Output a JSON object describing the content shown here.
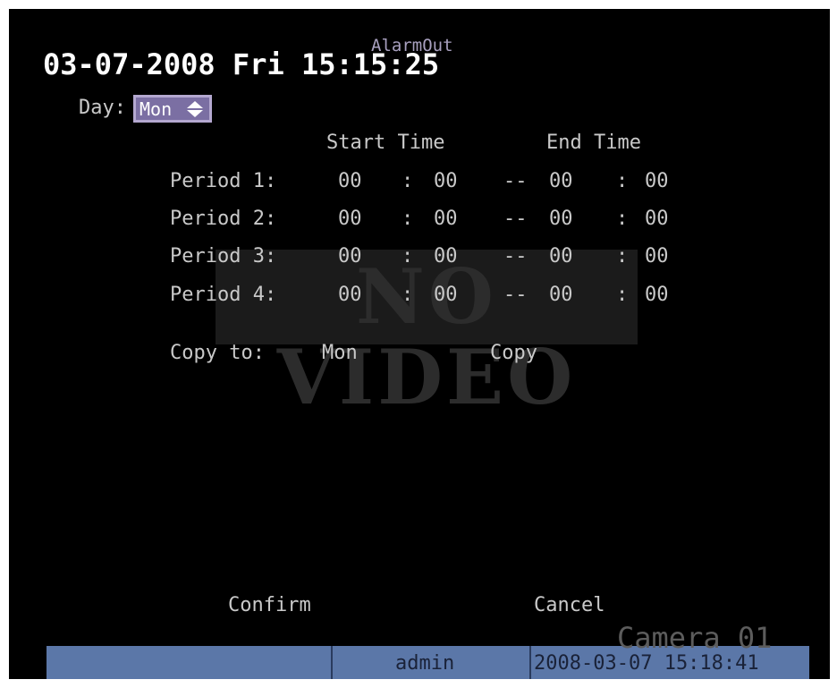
{
  "osd": {
    "datetime": "03-07-2008 Fri 15:15:25"
  },
  "menu": {
    "title": "AlarmOut"
  },
  "day": {
    "label": "Day:",
    "value": "Mon"
  },
  "headers": {
    "start": "Start Time",
    "end": "End Time"
  },
  "periods": [
    {
      "label": "Period 1:",
      "start_h": "00",
      "start_m": "00",
      "end_h": "00",
      "end_m": "00"
    },
    {
      "label": "Period 2:",
      "start_h": "00",
      "start_m": "00",
      "end_h": "00",
      "end_m": "00"
    },
    {
      "label": "Period 3:",
      "start_h": "00",
      "start_m": "00",
      "end_h": "00",
      "end_m": "00"
    },
    {
      "label": "Period 4:",
      "start_h": "00",
      "start_m": "00",
      "end_h": "00",
      "end_m": "00"
    }
  ],
  "separators": {
    "colon": ":",
    "dash": "--"
  },
  "copy": {
    "label": "Copy to:",
    "day": "Mon",
    "button": "Copy"
  },
  "actions": {
    "confirm": "Confirm",
    "cancel": "Cancel"
  },
  "overlay": {
    "no_video": "NO VIDEO",
    "camera": "Camera 01"
  },
  "status": {
    "user": "admin",
    "datetime": "2008-03-07 15:18:41"
  },
  "colors": {
    "background": "#000000",
    "status_bar": "#5b77a8",
    "selected": "#7b6fa3"
  }
}
